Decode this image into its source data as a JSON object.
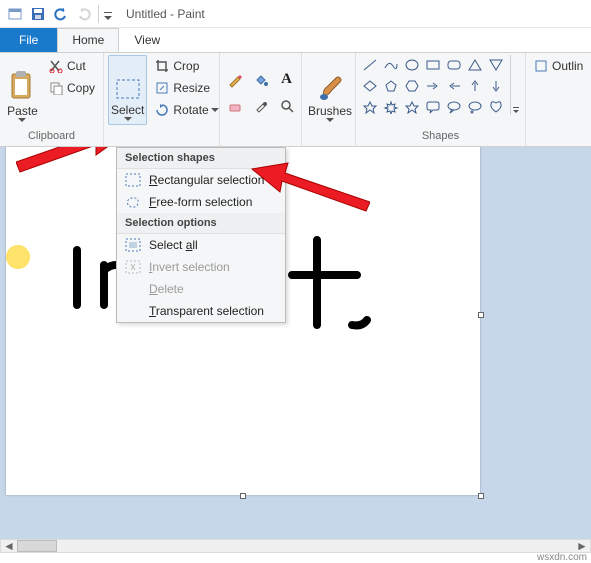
{
  "title": "Untitled - Paint",
  "tabs": {
    "file": "File",
    "home": "Home",
    "view": "View"
  },
  "clipboard": {
    "paste": "Paste",
    "cut": "Cut",
    "copy": "Copy",
    "group": "Clipboard"
  },
  "image": {
    "select": "Select",
    "crop": "Crop",
    "resize": "Resize",
    "rotate": "Rotate"
  },
  "brushes": "Brushes",
  "shapes": {
    "group": "Shapes",
    "outline": "Outlin"
  },
  "dropdown": {
    "shapes_hdr": "Selection shapes",
    "rect": "Rectangular selection",
    "free": "Free-form selection",
    "opts_hdr": "Selection options",
    "all": "Select all",
    "invert": "Invert selection",
    "delete": "Delete",
    "transparent": "Transparent selection"
  },
  "ink_text": "Invert",
  "watermark": "wsxdn.com"
}
